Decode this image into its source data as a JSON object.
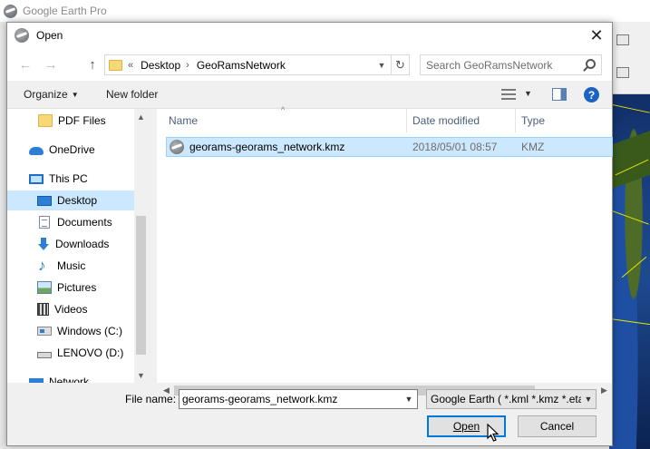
{
  "background_app": {
    "title": "Google Earth Pro"
  },
  "dialog": {
    "title": "Open",
    "close_glyph": "✕"
  },
  "navigation": {
    "back_glyph": "←",
    "forward_glyph": "→",
    "up_glyph": "↑",
    "breadcrumb_prefix": "«",
    "breadcrumbs": [
      "Desktop",
      "GeoRamsNetwork"
    ],
    "breadcrumb_sep": "›",
    "refresh_glyph": "↻",
    "search_placeholder": "Search GeoRamsNetwork"
  },
  "toolbar": {
    "organize": "Organize",
    "new_folder": "New folder",
    "help": "?"
  },
  "nav_pane": {
    "items": [
      {
        "label": "PDF Files",
        "icon": "folder-icon"
      },
      {
        "label": "OneDrive",
        "icon": "onedrive-icon"
      },
      {
        "label": "This PC",
        "icon": "this-pc-icon"
      },
      {
        "label": "Desktop",
        "icon": "desktop-icon",
        "selected": true
      },
      {
        "label": "Documents",
        "icon": "documents-icon"
      },
      {
        "label": "Downloads",
        "icon": "downloads-icon"
      },
      {
        "label": "Music",
        "icon": "music-icon"
      },
      {
        "label": "Pictures",
        "icon": "pictures-icon"
      },
      {
        "label": "Videos",
        "icon": "videos-icon"
      },
      {
        "label": "Windows (C:)",
        "icon": "windows-drive-icon"
      },
      {
        "label": "LENOVO (D:)",
        "icon": "drive-icon"
      },
      {
        "label": "Network",
        "icon": "network-icon"
      }
    ]
  },
  "file_list": {
    "columns": [
      "Name",
      "Date modified",
      "Type"
    ],
    "rows": [
      {
        "name": "georams-georams_network.kmz",
        "date": "2018/05/01 08:57",
        "type": "KMZ",
        "selected": true
      }
    ]
  },
  "bottom": {
    "file_name_label": "File name:",
    "file_name_value": "georams-georams_network.kmz",
    "file_type_filter": "Google Earth ( *.kml *.kmz *.eta",
    "open_label": "Open",
    "cancel_label": "Cancel"
  },
  "colors": {
    "selection": "#cce8ff",
    "selection_border": "#99d1ff",
    "accent": "#0078d7"
  }
}
